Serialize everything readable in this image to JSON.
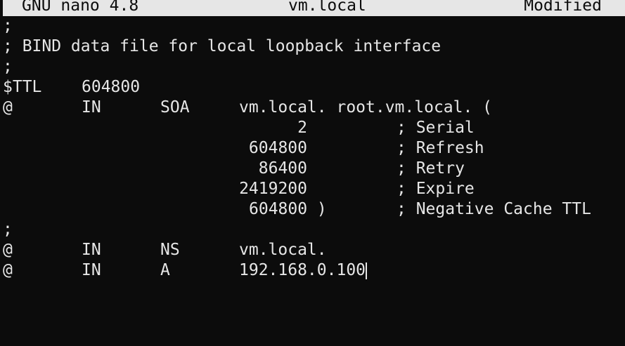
{
  "titlebar": {
    "app": "GNU nano 4.8",
    "filename": "vm.local",
    "status": "Modified"
  },
  "file": {
    "line1": ";",
    "line2": "; BIND data file for local loopback interface",
    "line3": ";",
    "line4": {
      "key": "$TTL",
      "value": "604800"
    },
    "line5": {
      "name": "@",
      "class": "IN",
      "type": "SOA",
      "data": "vm.local. root.vm.local. ("
    },
    "line6": {
      "value": "2",
      "comment": "; Serial"
    },
    "line7": {
      "value": "604800",
      "comment": "; Refresh"
    },
    "line8": {
      "value": "86400",
      "comment": "; Retry"
    },
    "line9": {
      "value": "2419200",
      "comment": "; Expire"
    },
    "line10": {
      "value": "604800 )",
      "comment": "; Negative Cache TTL"
    },
    "line11": ";",
    "line12": {
      "name": "@",
      "class": "IN",
      "type": "NS",
      "data": "vm.local."
    },
    "line13": {
      "name": "@",
      "class": "IN",
      "type": "A",
      "data": "192.168.0.100"
    }
  },
  "colors": {
    "background": "#0c0c0c",
    "foreground": "#e6e6e6",
    "titlebar_bg": "#e6e6e6",
    "titlebar_fg": "#0c0c0c"
  }
}
